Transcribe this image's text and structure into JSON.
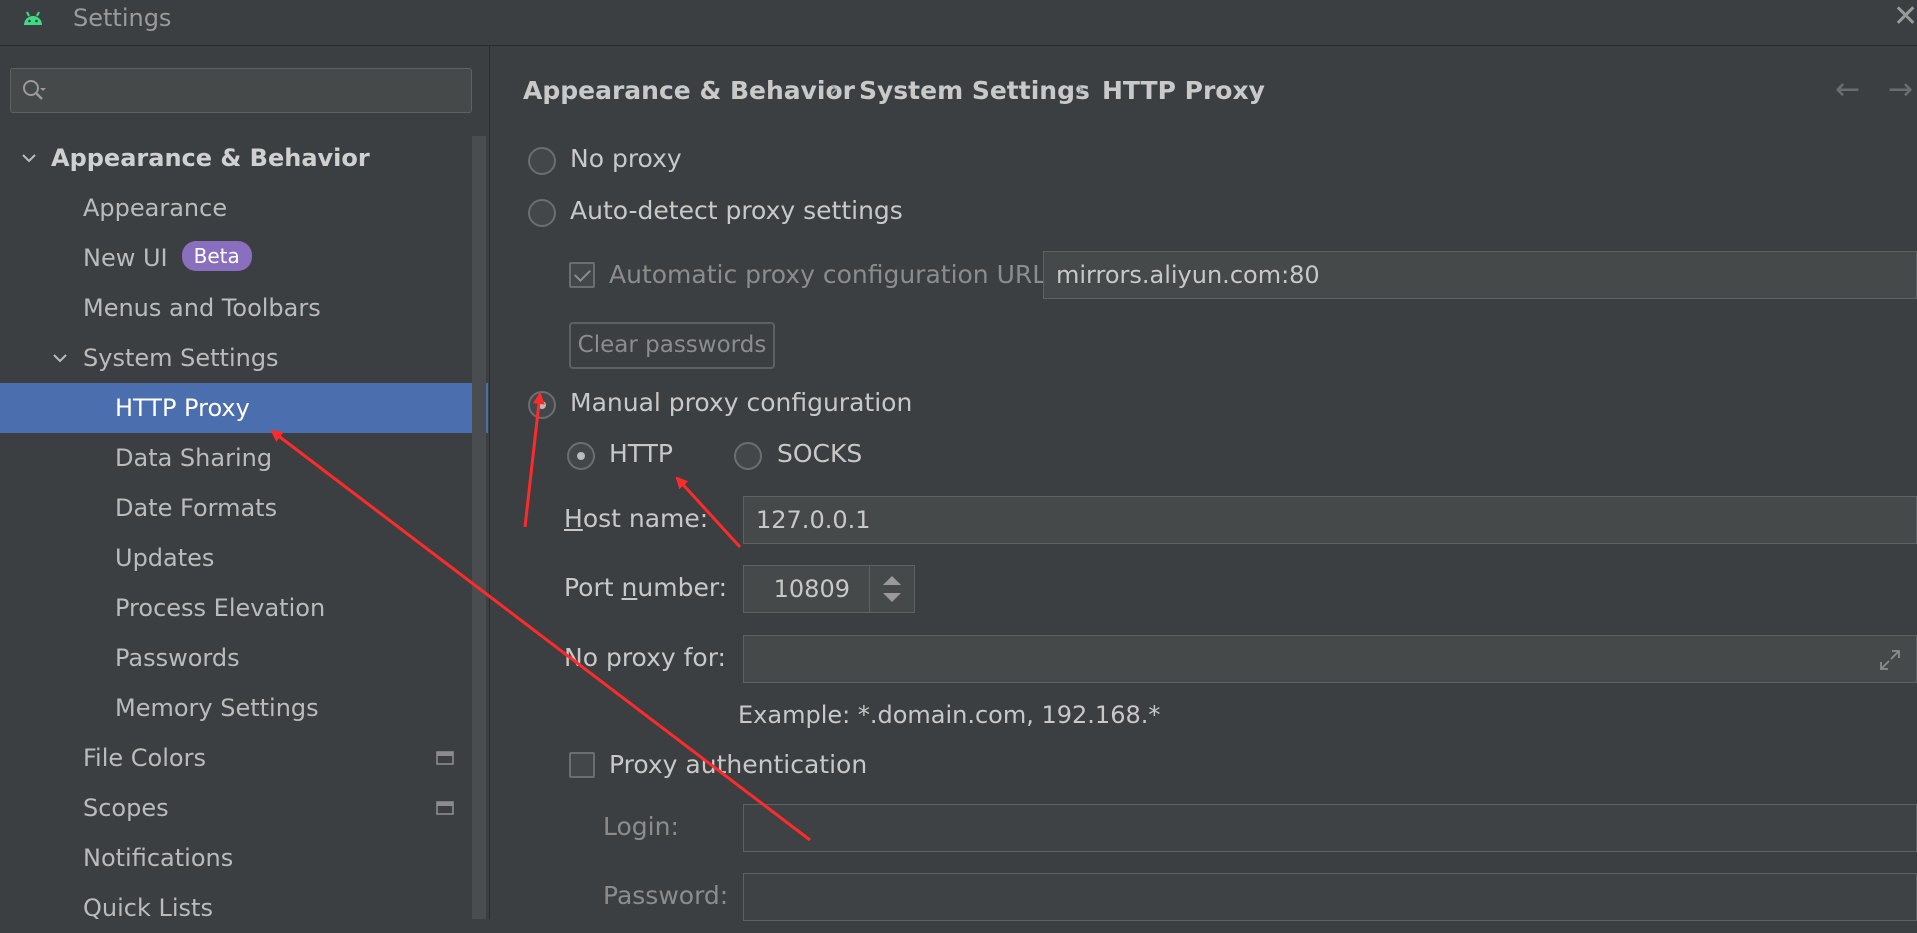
{
  "window": {
    "title": "Settings"
  },
  "sidebar": {
    "search_placeholder": "",
    "items": [
      {
        "label": "Appearance & Behavior"
      },
      {
        "label": "Appearance"
      },
      {
        "label": "New UI",
        "badge": "Beta"
      },
      {
        "label": "Menus and Toolbars"
      },
      {
        "label": "System Settings"
      },
      {
        "label": "HTTP Proxy"
      },
      {
        "label": "Data Sharing"
      },
      {
        "label": "Date Formats"
      },
      {
        "label": "Updates"
      },
      {
        "label": "Process Elevation"
      },
      {
        "label": "Passwords"
      },
      {
        "label": "Memory Settings"
      },
      {
        "label": "File Colors"
      },
      {
        "label": "Scopes"
      },
      {
        "label": "Notifications"
      },
      {
        "label": "Quick Lists"
      }
    ]
  },
  "breadcrumb": [
    "Appearance & Behavior",
    "System Settings",
    "HTTP Proxy"
  ],
  "proxy": {
    "no_proxy": "No proxy",
    "auto_detect": "Auto-detect proxy settings",
    "auto_url_label": "Automatic proxy configuration URL:",
    "auto_url_value": "mirrors.aliyun.com:80",
    "clear_passwords": "Clear passwords",
    "manual": "Manual proxy configuration",
    "http": "HTTP",
    "socks": "SOCKS",
    "host_label_first": "H",
    "host_label_rest": "ost name:",
    "host_value": "127.0.0.1",
    "port_label_pre": "Port ",
    "port_label_u": "n",
    "port_label_post": "umber:",
    "port_value": "10809",
    "no_proxy_for_label": "No proxy for:",
    "no_proxy_for_value": "",
    "example": "Example: *.domain.com, 192.168.*",
    "proxy_auth": "Proxy authentication",
    "login_label": "Login:",
    "password_label": "Password:"
  },
  "colors": {
    "selection": "#4b6eaf",
    "badge": "#8a6fbf",
    "annotation": "#ff2a2a"
  }
}
